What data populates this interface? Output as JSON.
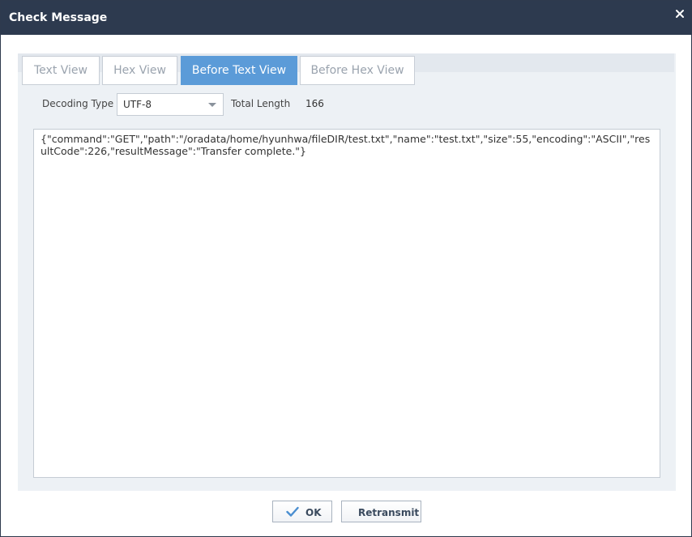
{
  "window": {
    "title": "Check Message",
    "close_icon": "close-icon"
  },
  "tabs": [
    {
      "label": "Text View",
      "active": false
    },
    {
      "label": "Hex View",
      "active": false
    },
    {
      "label": "Before Text View",
      "active": true
    },
    {
      "label": "Before Hex View",
      "active": false
    }
  ],
  "toolbar": {
    "decoding_label": "Decoding Type",
    "decoding_value": "UTF-8",
    "total_length_label": "Total Length",
    "total_length_value": "166"
  },
  "content": {
    "message": "{\"command\":\"GET\",\"path\":\"/oradata/home/hyunhwa/fileDIR/test.txt\",\"name\":\"test.txt\",\"size\":55,\"encoding\":\"ASCII\",\"resultCode\":226,\"resultMessage\":\"Transfer complete.\"}"
  },
  "buttons": {
    "ok_label": "OK",
    "ok_icon": "check-icon",
    "retransmit_label": "Retransmit"
  },
  "colors": {
    "titlebar": "#2d3a4f",
    "active_tab": "#5b9bd8",
    "check_icon": "#4a8ed0"
  }
}
